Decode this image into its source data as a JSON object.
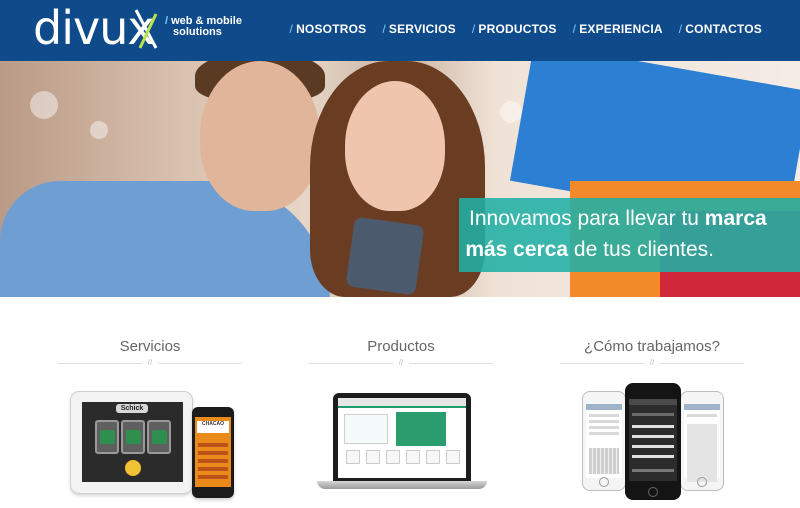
{
  "header": {
    "logo_text": "divux",
    "tagline_line1": "web & mobile",
    "tagline_line2": "solutions",
    "tagline_slash": "/",
    "nav": [
      {
        "label": "NOSOTROS"
      },
      {
        "label": "SERVICIOS"
      },
      {
        "label": "PRODUCTOS"
      },
      {
        "label": "EXPERIENCIA"
      },
      {
        "label": "CONTACTOS"
      }
    ],
    "colors": {
      "bar": "#0f4a8a",
      "accent": "#7ec8ff"
    }
  },
  "hero": {
    "line1_normal": "Innovamos para llevar tu ",
    "line1_bold": "marca",
    "line2_bold": "más cerca",
    "line2_normal": " de tus clientes.",
    "banner_color": "#20afa5"
  },
  "sections": [
    {
      "title": "Servicios"
    },
    {
      "title": "Productos"
    },
    {
      "title": "¿Cómo trabajamos?"
    }
  ],
  "illustrations": {
    "tablet_brand": "Schick",
    "phone_text": "CHACAO"
  }
}
